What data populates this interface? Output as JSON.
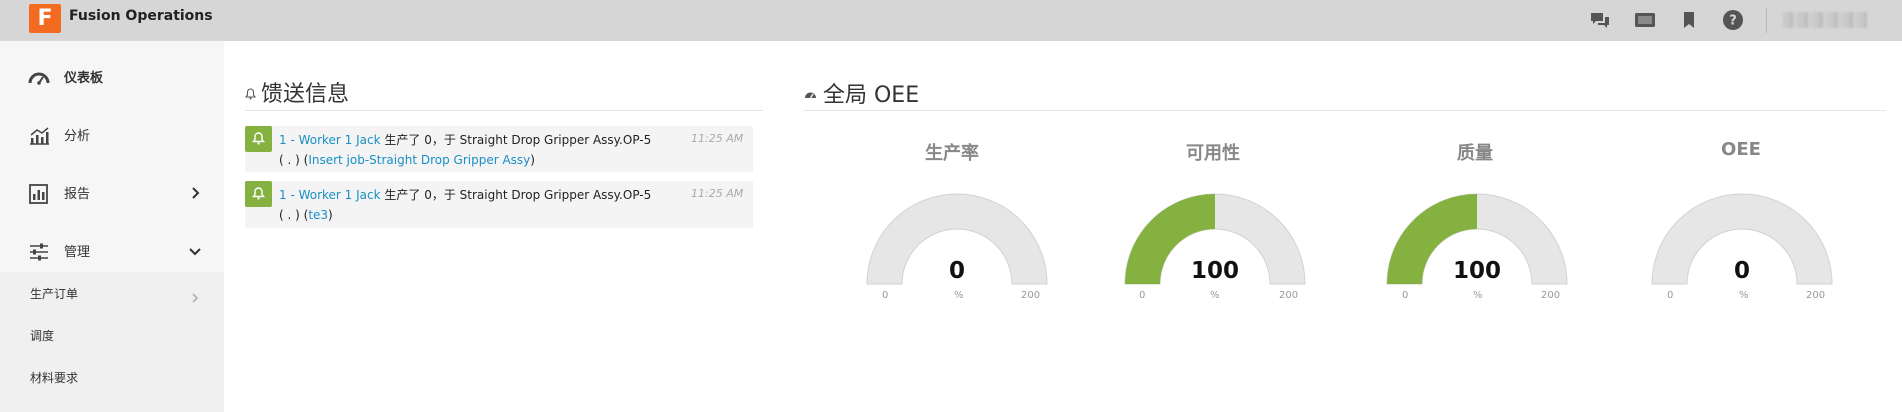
{
  "header": {
    "logo_letter": "F",
    "app_title": "Fusion Operations",
    "icons": [
      "chat-icon",
      "tablet-icon",
      "bookmark-icon",
      "help-icon"
    ]
  },
  "sidebar": {
    "items": [
      {
        "label": "仪表板",
        "icon": "dashboard-icon"
      },
      {
        "label": "分析",
        "icon": "analytics-icon"
      },
      {
        "label": "报告",
        "icon": "report-icon"
      },
      {
        "label": "管理",
        "icon": "sliders-icon"
      }
    ],
    "sub_items": [
      {
        "label": "生产订单"
      },
      {
        "label": "调度"
      },
      {
        "label": "材料要求"
      }
    ]
  },
  "feed": {
    "title": "馈送信息",
    "items": [
      {
        "worker": "1 - Worker 1 Jack",
        "message": " 生产了 0，于 Straight Drop Gripper Assy.OP-5",
        "line2_prefix": "( . ) (",
        "job": "Insert job-Straight Drop Gripper Assy",
        "line2_suffix": ")",
        "time": "11:25 AM"
      },
      {
        "worker": "1 - Worker 1 Jack",
        "message": " 生产了 0，于 Straight Drop Gripper Assy.OP-5",
        "line2_prefix": "( . ) (",
        "job": "te3",
        "line2_suffix": ")",
        "time": "11:25 AM"
      }
    ]
  },
  "oee": {
    "title": "全局 OEE",
    "accent": "#84b13f",
    "track": "#e6e6e6",
    "gauges": [
      {
        "title": "生产率",
        "value": "0",
        "fraction": 0,
        "min": "0",
        "max": "200",
        "unit": "%"
      },
      {
        "title": "可用性",
        "value": "100",
        "fraction": 0.5,
        "min": "0",
        "max": "200",
        "unit": "%"
      },
      {
        "title": "质量",
        "value": "100",
        "fraction": 0.5,
        "min": "0",
        "max": "200",
        "unit": "%"
      },
      {
        "title": "OEE",
        "value": "0",
        "fraction": 0,
        "min": "0",
        "max": "200",
        "unit": "%"
      }
    ]
  }
}
